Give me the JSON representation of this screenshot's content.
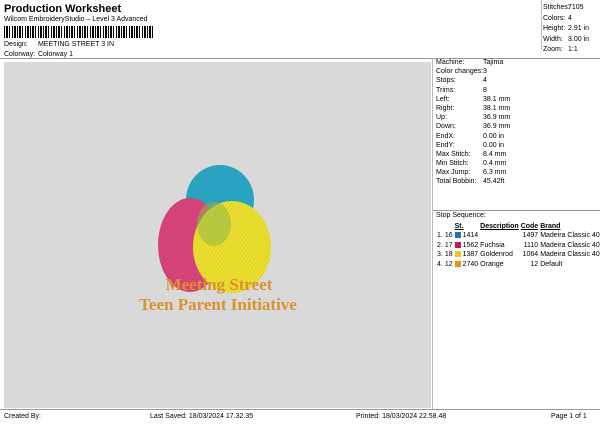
{
  "header": {
    "title": "Production Worksheet",
    "software": "Wilcom EmbroideryStudio – Level 3 Advanced",
    "design_label": "Design:",
    "design_value": "MEETING STREET 3 IN",
    "colorway_label": "Colorway:",
    "colorway_value": "Colorway 1"
  },
  "top_stats": [
    {
      "k": "Stitches:",
      "v": "7105"
    },
    {
      "k": "Colors:",
      "v": "4"
    },
    {
      "k": "Height:",
      "v": "2.91 in"
    },
    {
      "k": "Width:",
      "v": "3.00 in"
    },
    {
      "k": "Zoom:",
      "v": "1:1"
    }
  ],
  "machine_info": [
    {
      "k": "Machine:",
      "v": "Tajima"
    },
    {
      "k": "Color changes:",
      "v": "3"
    },
    {
      "k": "Stops:",
      "v": "4"
    },
    {
      "k": "Trims:",
      "v": "8"
    },
    {
      "k": "Left:",
      "v": "38.1 mm"
    },
    {
      "k": "Right:",
      "v": "38.1 mm"
    },
    {
      "k": "Up:",
      "v": "36.9 mm"
    },
    {
      "k": "Down:",
      "v": "36.9 mm"
    },
    {
      "k": "EndX:",
      "v": "0.00 in"
    },
    {
      "k": "EndY:",
      "v": "0.00 in"
    },
    {
      "k": "Max Stitch:",
      "v": "8.4 mm"
    },
    {
      "k": "Min Stitch:",
      "v": "0.4 mm"
    },
    {
      "k": "Max Jump:",
      "v": "6.3 mm"
    },
    {
      "k": "Total Bobbin:",
      "v": "45.42ft"
    }
  ],
  "stop_sequence": {
    "title": "Stop Sequence:",
    "headers": [
      "St.",
      "Description",
      "Code",
      "Brand"
    ],
    "rows": [
      {
        "idx": "1.",
        "needle": "16",
        "color": "#1f73b7",
        "st": "1414",
        "desc": "",
        "code": "1497",
        "brand": "Madeira Classic 40"
      },
      {
        "idx": "2.",
        "needle": "17",
        "color": "#c2185b",
        "st": "1562",
        "desc": "Fuchsia",
        "code": "1110",
        "brand": "Madeira Classic 40"
      },
      {
        "idx": "3.",
        "needle": "18",
        "color": "#f5c518",
        "st": "1387",
        "desc": "Goldenrod",
        "code": "1064",
        "brand": "Madeira Classic 40"
      },
      {
        "idx": "4.",
        "needle": "12",
        "color": "#e8901a",
        "st": "2740",
        "desc": "Orange",
        "code": "12",
        "brand": "Default"
      }
    ]
  },
  "design_text": {
    "line1": "Meeting Street",
    "line2": "Teen Parent Initiative"
  },
  "colors": {
    "teal": "#2aa6c4",
    "pink": "#d8457a",
    "yellow": "#ecdf2e",
    "orange": "#d9922e"
  },
  "footer": {
    "created": "Created By:",
    "last_saved": "Last Saved: 18/03/2024 17.32.35",
    "printed": "Printed: 18/03/2024 22.58.48",
    "page": "Page 1 of 1"
  }
}
